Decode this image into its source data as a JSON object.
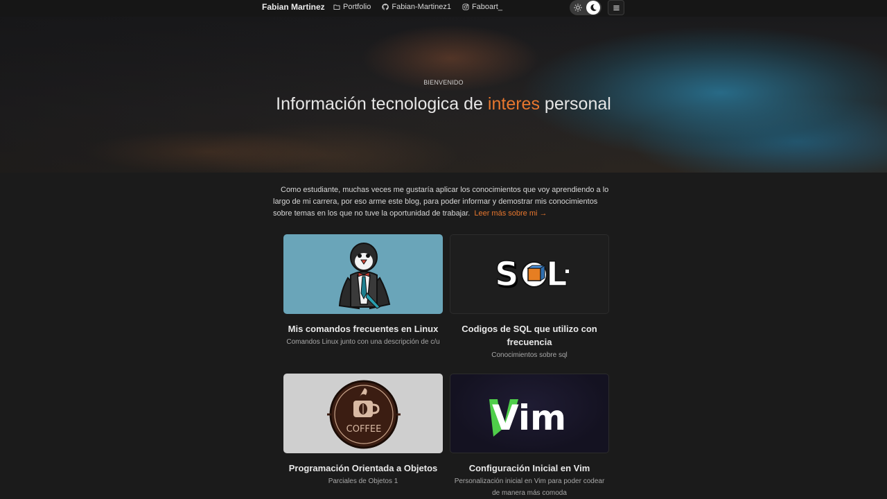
{
  "nav": {
    "brand": "Fabian Martinez",
    "links": [
      {
        "label": "Portfolio",
        "icon": "folder-icon"
      },
      {
        "label": "Fabian-Martinez1",
        "icon": "github-icon"
      },
      {
        "label": "Faboart_",
        "icon": "instagram-icon"
      }
    ],
    "theme_toggle": {
      "light_icon": "sun-icon",
      "dark_icon": "moon-icon",
      "active": "dark"
    },
    "menu_icon": "hamburger-menu-icon"
  },
  "hero": {
    "kicker": "BIENVENIDO",
    "title_before": "Información tecnologica de ",
    "title_accent": "interes",
    "title_after": " personal"
  },
  "intro": {
    "text": "Como estudiante, muchas veces me gustaría aplicar los conocimientos que voy aprendiendo a lo largo de mi carrera, por eso arme este blog, para poder informar y demostrar mis conocimientos sobre temas en los que no tuve la oportunidad de trabajar.",
    "read_more": "Leer más sobre mi →"
  },
  "cards": [
    {
      "title": "Mis comandos frecuentes en Linux",
      "description": "Comandos Linux junto con una descripción de c/u",
      "image": "linux-penguin-image"
    },
    {
      "title": "Codigos de SQL que utilizo con frecuencia",
      "description": "Conocimientos sobre sql",
      "image": "sql-logo-image",
      "image_text": "SQL"
    },
    {
      "title": "Programación Orientada a Objetos",
      "description": "Parciales de Objetos 1",
      "image": "coffee-badge-image",
      "image_text": "COFFEE"
    },
    {
      "title": "Configuración Inicial en Vim",
      "description": "Personalización inicial en Vim para poder codear de manera más comoda",
      "image": "vim-logo-image",
      "image_text": "Vim"
    }
  ],
  "colors": {
    "accent": "#e8772e",
    "background": "#1b1b1b",
    "linux_thumb_bg": "#6aa5b9",
    "vim_green": "#4fce4a"
  }
}
